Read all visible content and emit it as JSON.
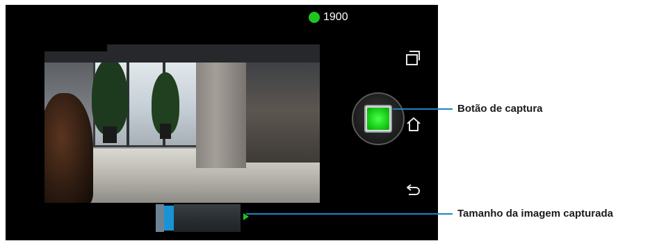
{
  "status": {
    "count": "1900",
    "indicator_color": "#1fc51f"
  },
  "capture": {
    "button_color": "#1dd41d"
  },
  "slider": {
    "thumb_color": "#1993d6"
  },
  "callouts": [
    {
      "label": "Botão de captura"
    },
    {
      "label": "Tamanho da imagem capturada"
    }
  ],
  "icons": {
    "recent": "recent-apps-icon",
    "home": "home-icon",
    "back": "back-icon"
  }
}
